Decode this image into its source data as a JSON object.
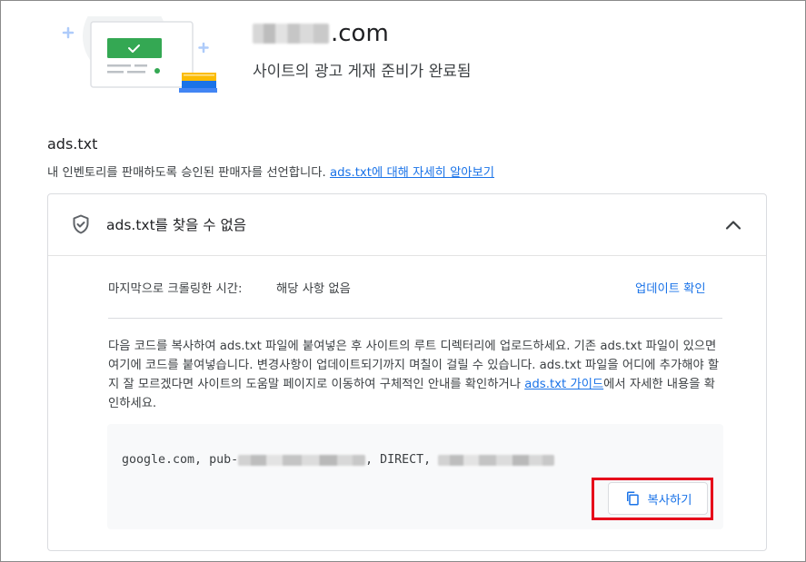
{
  "header": {
    "domain_suffix": ".com",
    "subtitle": "사이트의 광고 게재 준비가 완료됨"
  },
  "ads_txt": {
    "title": "ads.txt",
    "description": "내 인벤토리를 판매하도록 승인된 판매자를 선언합니다. ",
    "learn_more_link": "ads.txt에 대해 자세히 알아보기"
  },
  "card": {
    "status_icon": "shield-check-icon",
    "status_text": "ads.txt를 찾을 수 없음",
    "collapse_icon": "chevron-up-icon",
    "crawl_label": "마지막으로 크롤링한 시간:",
    "crawl_value": "해당 사항 없음",
    "update_button": "업데이트 확인",
    "instructions_text": "다음 코드를 복사하여 ads.txt 파일에 붙여넣은 후 사이트의 루트 디렉터리에 업로드하세요. 기존 ads.txt 파일이 있으면 여기에 코드를 붙여넣습니다. 변경사항이 업데이트되기까지 며칠이 걸릴 수 있습니다. ads.txt 파일을 어디에 추가해야 할지 잘 모르겠다면 사이트의 도움말 페이지로 이동하여 구체적인 안내를 확인하거나 ",
    "guide_link": "ads.txt 가이드",
    "instructions_tail": "에서 자세한 내용을 확인하세요.",
    "code": {
      "part1": "google.com, pub-",
      "part2": ", DIRECT, "
    },
    "copy_icon": "copy-icon",
    "copy_button": "복사하기"
  },
  "colors": {
    "accent": "#1a73e8",
    "highlight": "#e6001a",
    "text": "#202124"
  }
}
